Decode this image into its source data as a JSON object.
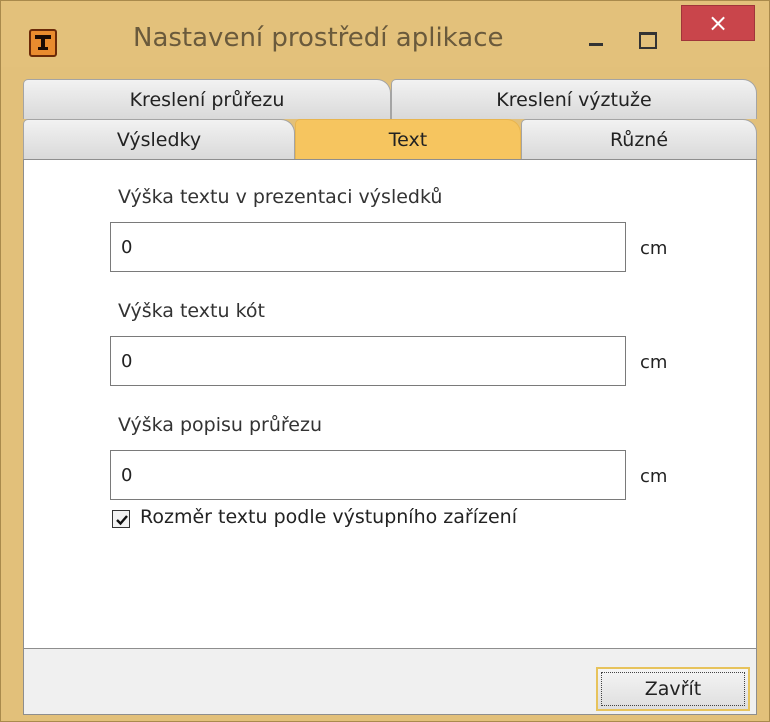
{
  "window": {
    "title": "Nastavení prostředí aplikace",
    "app_icon": "t-app-icon",
    "controls": {
      "minimize": "minimize-icon",
      "maximize": "maximize-icon",
      "close": "×"
    }
  },
  "tabs": {
    "row1": [
      {
        "label": "Kreslení průřezu"
      },
      {
        "label": "Kreslení výztuže"
      }
    ],
    "row2": [
      {
        "label": "Výsledky",
        "active": false
      },
      {
        "label": "Text",
        "active": true
      },
      {
        "label": "Různé",
        "active": false
      }
    ]
  },
  "panel": {
    "fields": [
      {
        "label": "Výška textu v prezentaci výsledků",
        "value": "0",
        "unit": "cm"
      },
      {
        "label": "Výška textu kót",
        "value": "0",
        "unit": "cm"
      },
      {
        "label": "Výška popisu průřezu",
        "value": "0",
        "unit": "cm"
      }
    ],
    "checkbox": {
      "label": "Rozměr textu podle výstupního zařízení",
      "checked": true
    }
  },
  "footer": {
    "close_label": "Zavřít"
  },
  "colors": {
    "active_tab": "#f6c55f",
    "titlebar": "#e3c17b",
    "close_button": "#c9454b"
  }
}
